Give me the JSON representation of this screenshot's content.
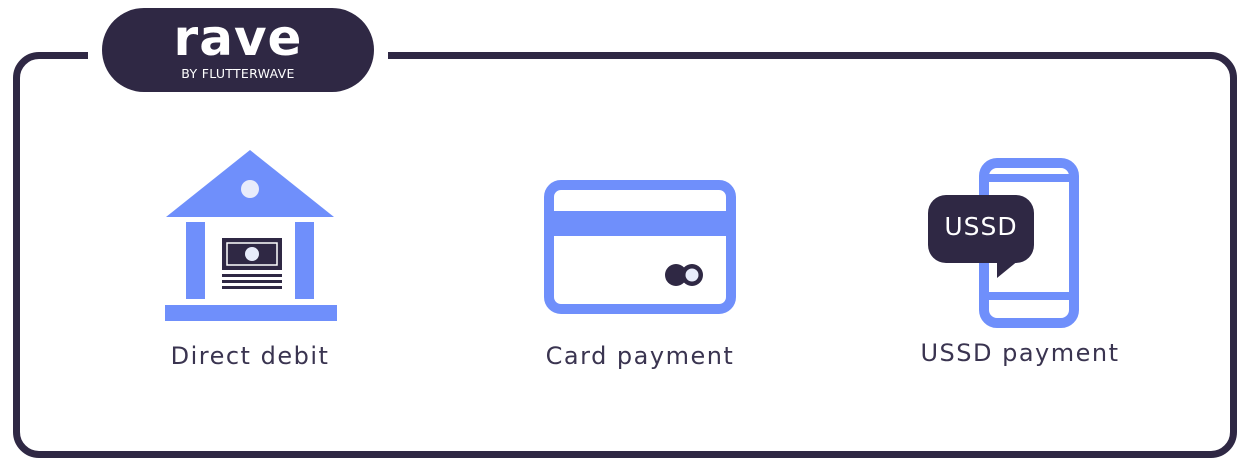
{
  "brand": {
    "name": "rave",
    "tagline": "BY FLUTTERWAVE",
    "dark_color": "#2f2844",
    "accent_color": "#6f8ffb"
  },
  "payment_options": [
    {
      "icon": "bank-icon",
      "label": "Direct debit"
    },
    {
      "icon": "credit-card-icon",
      "label": "Card payment"
    },
    {
      "icon": "phone-ussd-icon",
      "label": "USSD payment",
      "bubble_text": "USSD"
    }
  ]
}
